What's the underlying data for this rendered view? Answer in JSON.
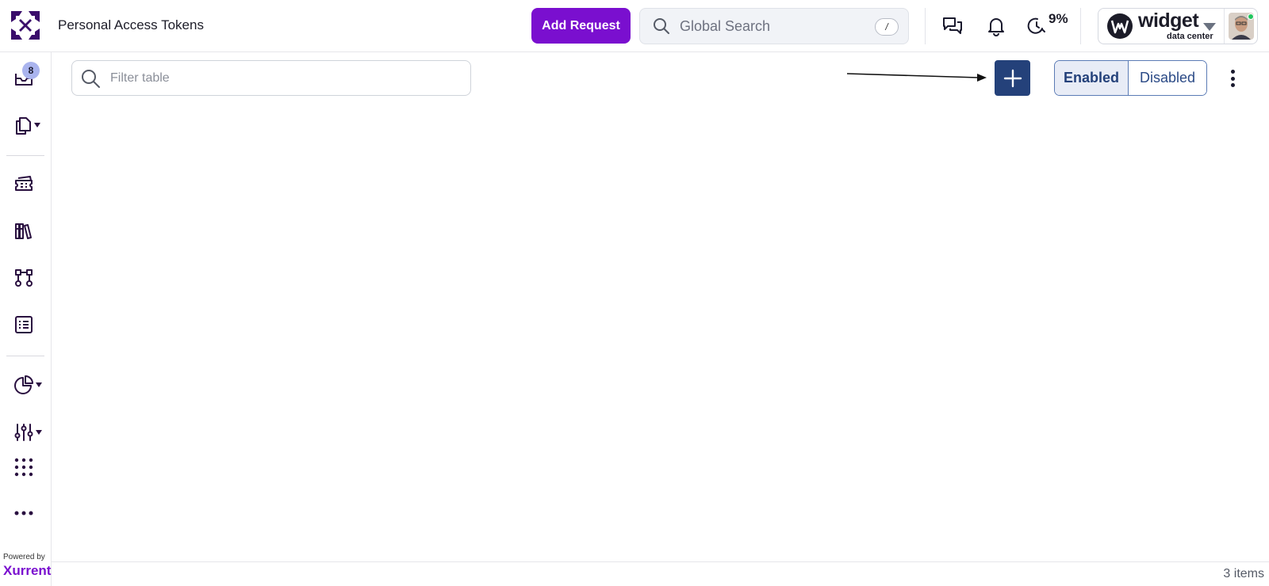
{
  "header": {
    "title": "Personal Access Tokens",
    "add_request_label": "Add Request",
    "search_placeholder": "Global Search",
    "search_shortcut": "/",
    "time_percent": "9%",
    "brand_name": "widget",
    "brand_subtitle": "data center",
    "brand_color": "#7a0fcf"
  },
  "sidebar": {
    "inbox_badge": "8",
    "items": [
      {
        "icon": "inbox-icon"
      },
      {
        "icon": "documents-icon",
        "dropdown": true
      },
      {
        "icon": "tickets-icon"
      },
      {
        "icon": "library-icon"
      },
      {
        "icon": "workflow-icon"
      },
      {
        "icon": "list-icon"
      },
      {
        "icon": "analytics-icon",
        "dropdown": true
      },
      {
        "icon": "settings-sliders-icon",
        "dropdown": true
      },
      {
        "icon": "apps-grid-icon"
      },
      {
        "icon": "more-icon"
      }
    ],
    "powered_by": "Powered by",
    "powered_brand": "Xurrent"
  },
  "toolbar": {
    "filter_placeholder": "Filter table",
    "add_icon": "plus-icon",
    "toggle_enabled": "Enabled",
    "toggle_disabled": "Disabled",
    "selected": "Enabled",
    "accent_color": "#24417a"
  },
  "footer": {
    "items_count": "3 items"
  }
}
